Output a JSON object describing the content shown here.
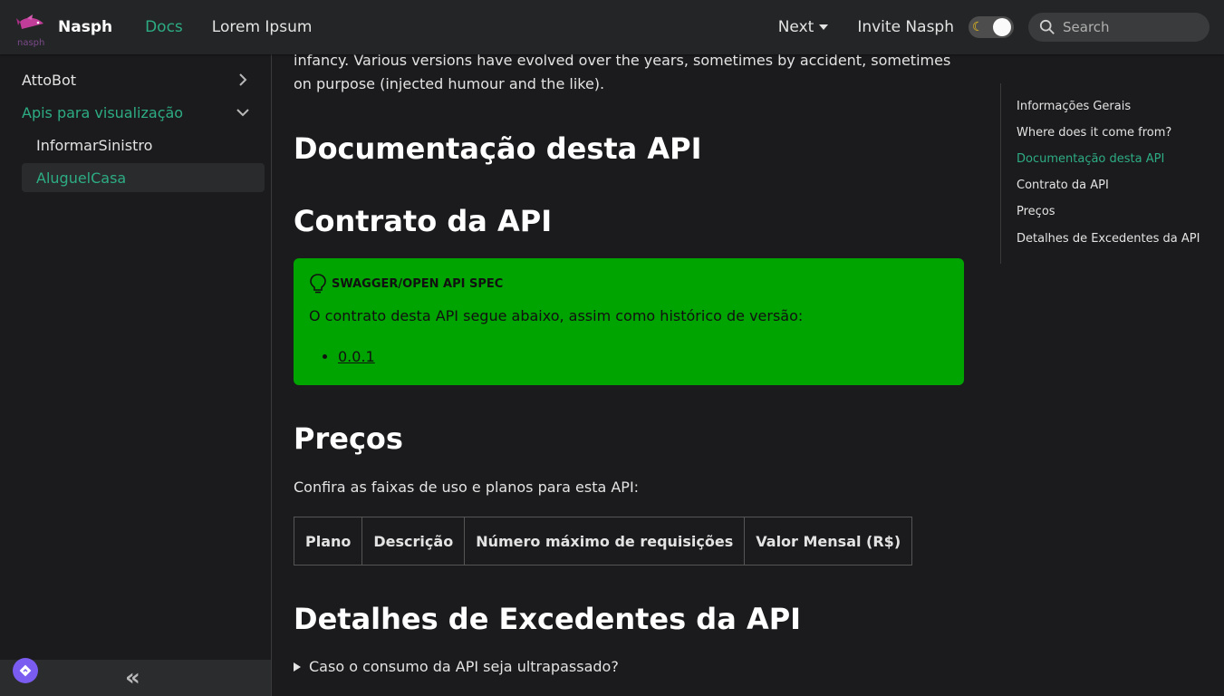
{
  "navbar": {
    "logo_text": "nasph",
    "brand": "Nasph",
    "links": [
      "Docs",
      "Lorem Ipsum"
    ],
    "next_label": "Next",
    "invite_label": "Invite Nasph",
    "search_placeholder": "Search"
  },
  "sidebar": {
    "items": [
      {
        "label": "AttoBot"
      },
      {
        "label": "Apis para visualização"
      },
      {
        "label": "InformarSinistro"
      },
      {
        "label": "AluguelCasa"
      }
    ]
  },
  "main": {
    "intro": "infancy. Various versions have evolved over the years, sometimes by accident, sometimes on purpose (injected humour and the like).",
    "heading_docs": "Documentação desta API",
    "heading_contract": "Contrato da API",
    "admonition": {
      "title": "SWAGGER/OPEN API SPEC",
      "body": "O contrato desta API segue abaixo, assim como histórico de versão:",
      "links": [
        "0.0.1"
      ]
    },
    "heading_prices": "Preços",
    "prices_text": "Confira as faixas de uso e planos para esta API:",
    "table_headers": [
      "Plano",
      "Descrição",
      "Número máximo de requisições",
      "Valor Mensal (R$)"
    ],
    "heading_details": "Detalhes de Excedentes da API",
    "details_summary": "Caso o consumo da API seja ultrapassado?"
  },
  "toc": {
    "items": [
      "Informações Gerais",
      "Where does it come from?",
      "Documentação desta API",
      "Contrato da API",
      "Preços",
      "Detalhes de Excedentes da API"
    ]
  },
  "colors": {
    "accent": "#2dac84",
    "admonition_bg": "#00a400",
    "background": "#1b1b1d",
    "navbar_bg": "#242526"
  }
}
